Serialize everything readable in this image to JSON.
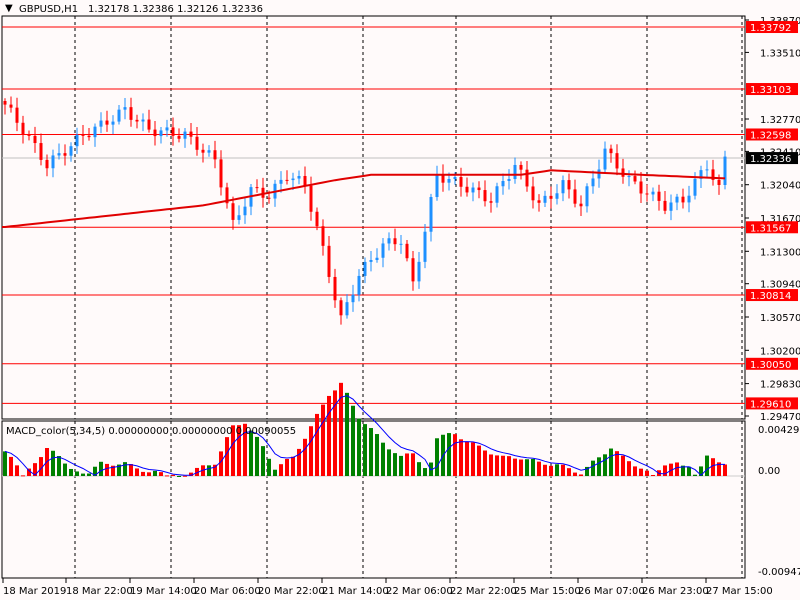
{
  "header": {
    "symbol": "GBPUSD,H1",
    "ohlc": "1.32178 1.32386 1.32126 1.32336"
  },
  "indicator": {
    "label": "MACD_color(5,34,5) 0.00000000 0.00000000 0.00090055",
    "max_label": "0.0042904",
    "zero_label": "0.00",
    "min_label": "-0.009479"
  },
  "colors": {
    "bull": "#1e90ff",
    "bear": "#ff0000",
    "level": "#ff0000",
    "ma": "#e00000",
    "hist_up": "#008000",
    "hist_down": "#ff0000",
    "signal": "#0000ff",
    "current": "#000000"
  },
  "chart_data": {
    "type": "candlestick",
    "symbol": "GBPUSD",
    "timeframe": "H1",
    "ylim": [
      1.2947,
      1.3387
    ],
    "price_ticks": [
      "1.33870",
      "1.33510",
      "1.32770",
      "1.32410",
      "1.32040",
      "1.31670",
      "1.31300",
      "1.30940",
      "1.30570",
      "1.30200",
      "1.29830",
      "1.29470"
    ],
    "levels": [
      "1.33792",
      "1.33103",
      "1.32598",
      "1.31567",
      "1.30814",
      "1.30050",
      "1.29610"
    ],
    "current_price": "1.32336",
    "time_labels": [
      "18 Mar 2019",
      "18 Mar 22:00",
      "19 Mar 14:00",
      "20 Mar 06:00",
      "20 Mar 22:00",
      "21 Mar 14:00",
      "22 Mar 06:00",
      "22 Mar 22:00",
      "25 Mar 15:00",
      "26 Mar 07:00",
      "26 Mar 23:00",
      "27 Mar 15:00"
    ],
    "bar_count": 121,
    "close_path": [
      [
        0,
        1.3293
      ],
      [
        3,
        1.3265
      ],
      [
        7,
        1.3226
      ],
      [
        10,
        1.3242
      ],
      [
        13,
        1.3259
      ],
      [
        16,
        1.327
      ],
      [
        20,
        1.3287
      ],
      [
        24,
        1.3265
      ],
      [
        30,
        1.3259
      ],
      [
        35,
        1.3231
      ],
      [
        38,
        1.3159
      ],
      [
        41,
        1.3198
      ],
      [
        44,
        1.3192
      ],
      [
        47,
        1.3215
      ],
      [
        50,
        1.3204
      ],
      [
        53,
        1.3131
      ],
      [
        56,
        1.3054
      ],
      [
        59,
        1.3104
      ],
      [
        63,
        1.3137
      ],
      [
        66,
        1.3143
      ],
      [
        68,
        1.3093
      ],
      [
        70,
        1.3154
      ],
      [
        72,
        1.3215
      ],
      [
        76,
        1.3204
      ],
      [
        81,
        1.3187
      ],
      [
        85,
        1.3226
      ],
      [
        89,
        1.3181
      ],
      [
        93,
        1.3204
      ],
      [
        96,
        1.3181
      ],
      [
        100,
        1.3242
      ],
      [
        104,
        1.3209
      ],
      [
        110,
        1.3181
      ],
      [
        113,
        1.3187
      ],
      [
        117,
        1.3226
      ],
      [
        119,
        1.3198
      ],
      [
        120,
        1.3234
      ]
    ],
    "ma_path": [
      [
        0,
        1.3157
      ],
      [
        33,
        1.3181
      ],
      [
        55,
        1.3209
      ],
      [
        61,
        1.3215
      ],
      [
        86,
        1.3215
      ],
      [
        91,
        1.322
      ],
      [
        106,
        1.3215
      ],
      [
        120,
        1.3211
      ]
    ],
    "macd_ylim": [
      -0.009479,
      0.0042904
    ],
    "macd_path": [
      [
        0,
        0.0024
      ],
      [
        3,
        0.0002
      ],
      [
        7,
        -0.0028
      ],
      [
        10,
        -0.0013
      ],
      [
        16,
        0.0012
      ],
      [
        20,
        0.0012
      ],
      [
        24,
        0.0004
      ],
      [
        29,
        0.0
      ],
      [
        35,
        -0.0013
      ],
      [
        38,
        -0.0048
      ],
      [
        40,
        -0.0053
      ],
      [
        43,
        -0.0028
      ],
      [
        45,
        -0.0008
      ],
      [
        48,
        -0.0018
      ],
      [
        51,
        -0.0048
      ],
      [
        54,
        -0.008
      ],
      [
        56,
        -0.009
      ],
      [
        59,
        -0.0058
      ],
      [
        63,
        -0.0033
      ],
      [
        66,
        -0.0018
      ],
      [
        68,
        -0.0023
      ],
      [
        70,
        -0.0008
      ],
      [
        72,
        0.0038
      ],
      [
        75,
        0.0041
      ],
      [
        79,
        0.0028
      ],
      [
        83,
        0.0018
      ],
      [
        86,
        0.0018
      ],
      [
        89,
        0.0013
      ],
      [
        92,
        0.0011
      ],
      [
        96,
        0.0003
      ],
      [
        99,
        0.0018
      ],
      [
        101,
        0.0028
      ],
      [
        103,
        0.0018
      ],
      [
        106,
        0.0008
      ],
      [
        109,
        -0.0005
      ],
      [
        112,
        -0.0015
      ],
      [
        114,
        -0.0008
      ],
      [
        117,
        0.0018
      ],
      [
        120,
        0.0013
      ]
    ]
  }
}
